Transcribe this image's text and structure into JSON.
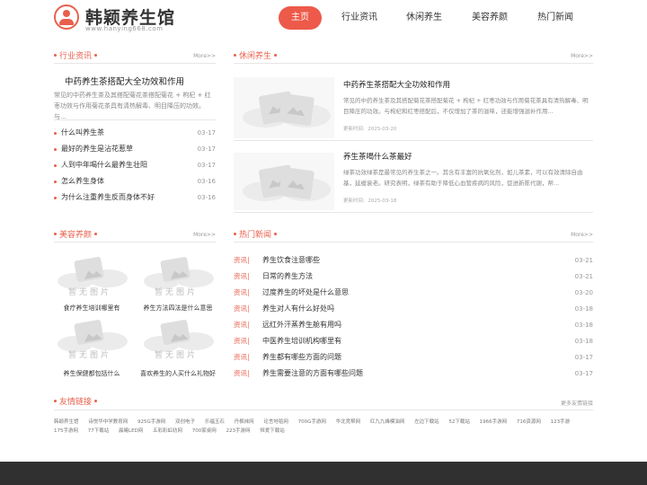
{
  "header": {
    "logo_name": "韩颖养生馆",
    "logo_url": "www.hanying668.com",
    "nav": [
      "主页",
      "行业资讯",
      "休闲养生",
      "美容养颜",
      "热门新闻"
    ]
  },
  "industry": {
    "title": "行业资讯",
    "more": "More>>",
    "feature_title": "中药养生茶搭配大全功效和作用",
    "feature_desc": "常见的中药养生茶及其搭配菊花茶搭配菊花 + 枸杞 + 红枣功效与作用菊花茶具有清热解毒、明目降压的功效。与...",
    "items": [
      {
        "text": "什么叫养生茶",
        "date": "03-17"
      },
      {
        "text": "最好的养生是沾花惹草",
        "date": "03-17"
      },
      {
        "text": "人到中年喝什么最养生壮阳",
        "date": "03-17"
      },
      {
        "text": "怎么养生身体",
        "date": "03-16"
      },
      {
        "text": "为什么注重养生反而身体不好",
        "date": "03-16"
      }
    ]
  },
  "leisure": {
    "title": "休闲养生",
    "more": "More>>",
    "cards": [
      {
        "title": "中药养生茶搭配大全功效和作用",
        "desc": "常见的中药养生茶及其搭配菊花茶搭配菊花 + 枸杞 + 红枣功效与作用菊花茶具有清热解毒、明目降压的功效。与枸杞和红枣搭配后，不仅增加了茶的滋味，还能增强滋补作用...",
        "meta_label": "更新时间:",
        "meta_date": "2025-03-20"
      },
      {
        "title": "养生茶喝什么茶最好",
        "desc": "绿茶功效绿茶是最常见的养生茶之一。其含有丰富的抗氧化剂，如儿茶素，可以有效清除自由基，延缓衰老。研究表明，绿茶有助于降低心血管疾病的风险，促进新陈代谢，帮...",
        "meta_label": "更新时间:",
        "meta_date": "2025-03-18"
      }
    ]
  },
  "beauty": {
    "title": "美容养颜",
    "more": "More>>",
    "placeholder": "暂无图片",
    "items": [
      "食疗养生培训哪里有",
      "养生方法四法是什么意思",
      "养生保健都包括什么",
      "喜欢养生的人买什么礼物好"
    ]
  },
  "hot": {
    "title": "热门新闻",
    "more": "More>>",
    "items": [
      {
        "tag": "资讯|",
        "text": "养生饮食注意哪些",
        "date": "03-21"
      },
      {
        "tag": "资讯|",
        "text": "日常的养生方法",
        "date": "03-21"
      },
      {
        "tag": "资讯|",
        "text": "过度养生的坏处是什么意思",
        "date": "03-20"
      },
      {
        "tag": "资讯|",
        "text": "养生对人有什么好处吗",
        "date": "03-18"
      },
      {
        "tag": "资讯|",
        "text": "远红外汗蒸养生舱有用吗",
        "date": "03-18"
      },
      {
        "tag": "资讯|",
        "text": "中医养生培训机构哪里有",
        "date": "03-18"
      },
      {
        "tag": "资讯|",
        "text": "养生都有哪些方面的问题",
        "date": "03-17"
      },
      {
        "tag": "资讯|",
        "text": "养生需要注意的方面有哪些问题",
        "date": "03-17"
      }
    ]
  },
  "friend_links": {
    "title": "友情链接",
    "more": "更多友情链接",
    "items": [
      "韩颖养生馆",
      "诗悦华中学教育网",
      "925G手游网",
      "双创电子",
      "乐福玉石",
      "丹枫袜网",
      "论言地毯网",
      "700G手游网",
      "华北竞帮网",
      "红九九峰模油网",
      "左边下载站",
      "52下载站",
      "1966手游网",
      "716资源网",
      "123手游",
      "175手游网",
      "77下载站",
      "晨曦LED网",
      "五彩彩虹纺网",
      "700家桌网",
      "223手游网",
      "恒爱下载站"
    ]
  },
  "colors": {
    "accent": "#e8604c",
    "footer": "#303030"
  }
}
